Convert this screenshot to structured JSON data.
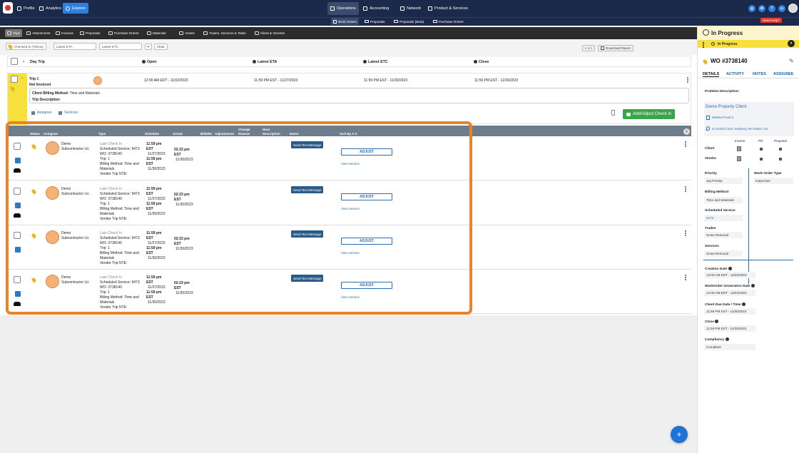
{
  "topnav": {
    "profile": "Profile",
    "analytics": "Analytics",
    "explore": "Explore",
    "operations": "Operations",
    "accounting": "Accounting",
    "network": "Network",
    "product_services": "Product & Services"
  },
  "subnav": {
    "work_orders": "Work Orders",
    "proposals": "Proposals",
    "proposals_beta": "Proposals (Beta)",
    "purchase_orders": "Purchase Orders"
  },
  "need_help": "Need Help?",
  "tabs": [
    "Trips",
    "Attachments",
    "Invoices",
    "Proposals",
    "Purchase Orders",
    "Materials",
    "Assets",
    "Trades, Services & Tasks",
    "Client & Vendors"
  ],
  "filters": {
    "checked_in": "Checked In (Yellow)",
    "latest_eta": "Latest ETA",
    "latest_etc": "Latest ETC",
    "clear": "Clear",
    "pager": "< 1 >",
    "download": "Download Report"
  },
  "table_header": {
    "day_trip": "Day Trip",
    "open": "Open",
    "latest_eta": "Latest ETA",
    "latest_etc": "Latest ETC",
    "close": "Close"
  },
  "trip": {
    "title": "Trip 1",
    "status": "Not Invoiced",
    "open": "12:00 AM EDT - 11/02/2023",
    "latest_eta": "11:59 PM EST - 11/27/2023",
    "latest_etc": "11:59 PM EST - 11/30/2023",
    "close": "11:59 PM EST - 11/30/2023",
    "billing_label": "Client Billing Method:",
    "billing_value": "Time and Materials",
    "trip_desc_label": "Trip Description:",
    "assignee_link": "Assignee",
    "services_link": "Services",
    "add_check_in": "Add/Adjust Check In"
  },
  "checkins_header": {
    "status": "Status",
    "assignee": "Assignee",
    "type": "Type",
    "schedule": "Schedule",
    "actual": "Actual",
    "billable": "Billable",
    "adjustments": "Adjustments",
    "change_reason": "Change Reason",
    "hour_description": "Hour Description",
    "notes": "Notes",
    "sort": "Sort By A-Z"
  },
  "checkins": [
    {
      "assignee1": "Demo",
      "assignee2": "Subcontractor Llc",
      "type": "Late Check In",
      "service": "Scheduled Service: 9473",
      "wo": "WO: 3738140",
      "trip": "Trip: 1",
      "billing1": "Billing Method: Time and",
      "billing2": "Materials",
      "nte": "Vendor Trip NTE:",
      "s1": "11:59 pm",
      "s2": "EST",
      "s3": "11/27/2023",
      "s4": "11:59 pm",
      "s5": "EST",
      "s6": "11/30/2023",
      "a1": "02:23 pm",
      "a2": "EST",
      "a3": "11/30/2023",
      "send": "Send Text Message",
      "adjust": "ADJUST",
      "view": "View Service"
    },
    {
      "assignee1": "Demo",
      "assignee2": "Subcontractor Llc",
      "type": "Late Check In",
      "service": "Scheduled Service: 9473",
      "wo": "WO: 3738140",
      "trip": "Trip: 1",
      "billing1": "Billing Method: Time and",
      "billing2": "Materials",
      "nte": "Vendor Trip NTE:",
      "s1": "11:59 pm",
      "s2": "EST",
      "s3": "11/27/2023",
      "s4": "11:59 pm",
      "s5": "EST",
      "s6": "11/30/2023",
      "a1": "02:23 pm",
      "a2": "EST",
      "a3": "11/30/2023",
      "send": "Send Text Message",
      "adjust": "ADJUST",
      "view": "View Service"
    },
    {
      "assignee1": "Demo",
      "assignee2": "Subcontractor Llc",
      "type": "Late Check In",
      "service": "Scheduled Service: 9473",
      "wo": "WO: 3738140",
      "trip": "Trip: 1",
      "billing1": "Billing Method: Time and",
      "billing2": "Materials",
      "nte": "Vendor Trip NTE:",
      "s1": "11:59 pm",
      "s2": "EST",
      "s3": "11/27/2023",
      "s4": "11:59 pm",
      "s5": "EST",
      "s6": "11/30/2023",
      "a1": "02:23 pm",
      "a2": "EST",
      "a3": "11/30/2023",
      "send": "Send Text Message",
      "adjust": "ADJUST",
      "view": "View Service"
    },
    {
      "assignee1": "Demo",
      "assignee2": "Subcontractor Llc",
      "type": "Late Check In",
      "service": "Scheduled Service: 9473",
      "wo": "WO: 3738140",
      "trip": "Trip: 1",
      "billing1": "Billing Method: Time and",
      "billing2": "Materials",
      "nte": "Vendor Trip NTE:",
      "s1": "11:59 pm",
      "s2": "EST",
      "s3": "11/27/2023",
      "s4": "11:59 pm",
      "s5": "EST",
      "s6": "11/30/2023",
      "a1": "02:23 pm",
      "a2": "EST",
      "a3": "11/30/2023",
      "send": "Send Text Message",
      "adjust": "ADJUST",
      "view": "View Service"
    }
  ],
  "right_panel": {
    "header": "In Progress",
    "status": "In Progress",
    "wo": "WO #3738140",
    "tabs": [
      "DETAILS",
      "ACTIVITY",
      "NOTES",
      "ASSIGNEE"
    ],
    "problem_description": "Problem Description:",
    "client_name": "Demo Property Client",
    "store": "Martins Food 3",
    "address": "5 Central Court, Newbury, MA 01922, US",
    "invoice": "Invoice",
    "po": "PO",
    "proposal": "Proposal",
    "client": "Client",
    "vendor": "Vendor",
    "priority_label": "Priority",
    "priority": "Jay Priority",
    "wo_type_label": "Work Order Type",
    "wo_type": "Inspection",
    "billing_label": "Billing Method",
    "billing": "Time and Materials",
    "sched_label": "Scheduled Service",
    "sched": "9473",
    "trades_label": "Trades",
    "trades": "Snow Removal",
    "services_label": "Services",
    "services": "Snow Removal",
    "creation_label": "Creation Date",
    "creation": "12:00 AM EDT - 11/02/2023",
    "gen_label": "WorkOrder Generation Date",
    "gen": "12:00 AM EDT - 11/02/2023",
    "due_label": "Client Due Date / Time",
    "due": "11:59 PM EST - 11/30/2023",
    "close_label": "Close",
    "close": "11:59 PM EST - 11/30/2023",
    "compliancy_label": "Compliancy",
    "compliancy": "Compliant"
  },
  "colors": {
    "navy": "#1b2a4a",
    "yellow": "#f7e03b",
    "orange": "#e8832a",
    "green": "#3aa44a",
    "blue": "#2b6fb0"
  }
}
